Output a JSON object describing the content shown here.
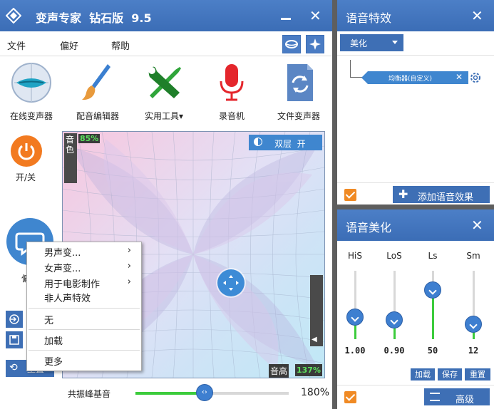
{
  "main": {
    "title": "变声专家  钻石版  9.5",
    "menu": [
      "文件",
      "偏好",
      "帮助"
    ],
    "tools": [
      "在线变声器",
      "配音编辑器",
      "实用工具",
      "录音机",
      "文件变声器"
    ],
    "power_label": "开/关",
    "side_label": "偏",
    "reset_label": "重置",
    "pad": {
      "timbre_label": "音色",
      "timbre_value": "85%",
      "pitch_label": "音高",
      "pitch_value": "137%",
      "dual_label": "双层  开"
    },
    "context_menu": [
      "男声变...",
      "女声变...",
      "用于电影制作",
      "非人声特效",
      "无",
      "加载",
      "更多"
    ],
    "resonance": {
      "label": "共振峰基音",
      "value": "180%",
      "level": 0.45
    }
  },
  "effects": {
    "title": "语音特效",
    "dropdown": "美化",
    "node_label": "均衡器(自定义)",
    "add_label": "添加语音效果"
  },
  "beautify": {
    "title": "语音美化",
    "sliders": [
      {
        "name": "HiS",
        "value": "1.00",
        "level": 0.32
      },
      {
        "name": "LoS",
        "value": "0.90",
        "level": 0.28
      },
      {
        "name": "Ls",
        "value": "50",
        "level": 0.72
      },
      {
        "name": "Sm",
        "value": "12",
        "level": 0.22
      }
    ],
    "load_label": "加载",
    "save_label": "保存",
    "reset_label": "重置",
    "advanced_label": "高级"
  },
  "colors": {
    "title_bar": "#3b6db6",
    "accent_orange": "#f08a24",
    "slider_fill": "#3ccc3c"
  }
}
